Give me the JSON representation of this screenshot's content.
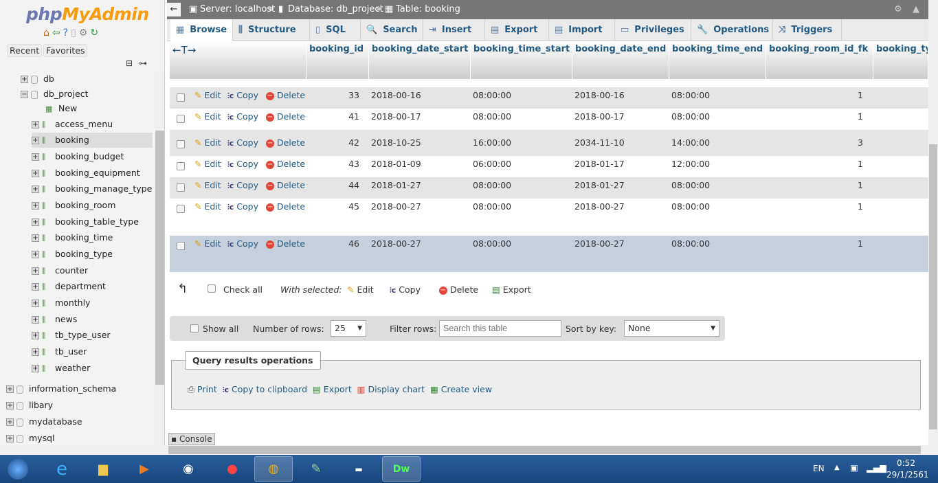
{
  "sidebar": {
    "logo_php": "php",
    "logo_myadmin": "MyAdmin",
    "recent": "Recent",
    "favorites": "Favorites",
    "tree": [
      {
        "label": "db",
        "level": 0
      },
      {
        "label": "db_project",
        "level": 0,
        "expanded": true
      },
      {
        "label": "New",
        "level": 1
      },
      {
        "label": "access_menu",
        "level": 1
      },
      {
        "label": "booking",
        "level": 1,
        "selected": true
      },
      {
        "label": "booking_budget",
        "level": 1
      },
      {
        "label": "booking_equipment",
        "level": 1
      },
      {
        "label": "booking_manage_type",
        "level": 1
      },
      {
        "label": "booking_room",
        "level": 1
      },
      {
        "label": "booking_table_type",
        "level": 1
      },
      {
        "label": "booking_time",
        "level": 1
      },
      {
        "label": "booking_type",
        "level": 1
      },
      {
        "label": "counter",
        "level": 1
      },
      {
        "label": "department",
        "level": 1
      },
      {
        "label": "monthly",
        "level": 1
      },
      {
        "label": "news",
        "level": 1
      },
      {
        "label": "tb_type_user",
        "level": 1
      },
      {
        "label": "tb_user",
        "level": 1
      },
      {
        "label": "weather",
        "level": 1
      }
    ],
    "roots": [
      "information_schema",
      "libary",
      "mydatabase",
      "mysql"
    ]
  },
  "breadcrumb": {
    "server": "Server: localhost",
    "database": "Database: db_project",
    "table": "Table: booking",
    "sep": "»"
  },
  "tabs": [
    {
      "label": "Browse",
      "icon": "▦"
    },
    {
      "label": "Structure",
      "icon": "⫼"
    },
    {
      "label": "SQL",
      "icon": "▯"
    },
    {
      "label": "Search",
      "icon": "🔍"
    },
    {
      "label": "Insert",
      "icon": "⇥"
    },
    {
      "label": "Export",
      "icon": "▤"
    },
    {
      "label": "Import",
      "icon": "▤"
    },
    {
      "label": "Privileges",
      "icon": "▭"
    },
    {
      "label": "Operations",
      "icon": "🔧"
    },
    {
      "label": "Triggers",
      "icon": "⤨"
    }
  ],
  "table": {
    "sort_arrows": "←T→",
    "columns": [
      "booking_id",
      "booking_date_start",
      "booking_time_start",
      "booking_date_end",
      "booking_time_end",
      "booking_room_id_fk",
      "booking_ty"
    ],
    "actions": {
      "edit": "Edit",
      "copy": "Copy",
      "delete": "Delete"
    },
    "rows": [
      [
        "33",
        "2018-00-16",
        "08:00:00",
        "2018-00-16",
        "08:00:00",
        "1"
      ],
      [
        "41",
        "2018-00-17",
        "08:00:00",
        "2018-00-17",
        "08:00:00",
        "1"
      ],
      [
        "42",
        "2018-10-25",
        "16:00:00",
        "2034-11-10",
        "14:00:00",
        "3"
      ],
      [
        "43",
        "2018-01-09",
        "06:00:00",
        "2018-01-17",
        "12:00:00",
        "1"
      ],
      [
        "44",
        "2018-01-27",
        "08:00:00",
        "2018-01-27",
        "08:00:00",
        "1"
      ],
      [
        "45",
        "2018-00-27",
        "08:00:00",
        "2018-00-27",
        "08:00:00",
        "1"
      ],
      [
        "46",
        "2018-00-27",
        "08:00:00",
        "2018-00-27",
        "08:00:00",
        "1"
      ]
    ]
  },
  "bulk": {
    "check_all": "Check all",
    "with_selected": "With selected:",
    "edit": "Edit",
    "copy": "Copy",
    "delete": "Delete",
    "export": "Export"
  },
  "controls": {
    "show_all": "Show all",
    "num_rows_label": "Number of rows:",
    "num_rows": "25",
    "filter_label": "Filter rows:",
    "filter_placeholder": "Search this table",
    "sort_label": "Sort by key:",
    "sort_value": "None"
  },
  "qro": {
    "title": "Query results operations",
    "print": "Print",
    "copy_clip": "Copy to clipboard",
    "export": "Export",
    "chart": "Display chart",
    "view": "Create view"
  },
  "console": "Console",
  "taskbar": {
    "lang": "EN",
    "time": "0:52",
    "date": "29/1/2561"
  }
}
